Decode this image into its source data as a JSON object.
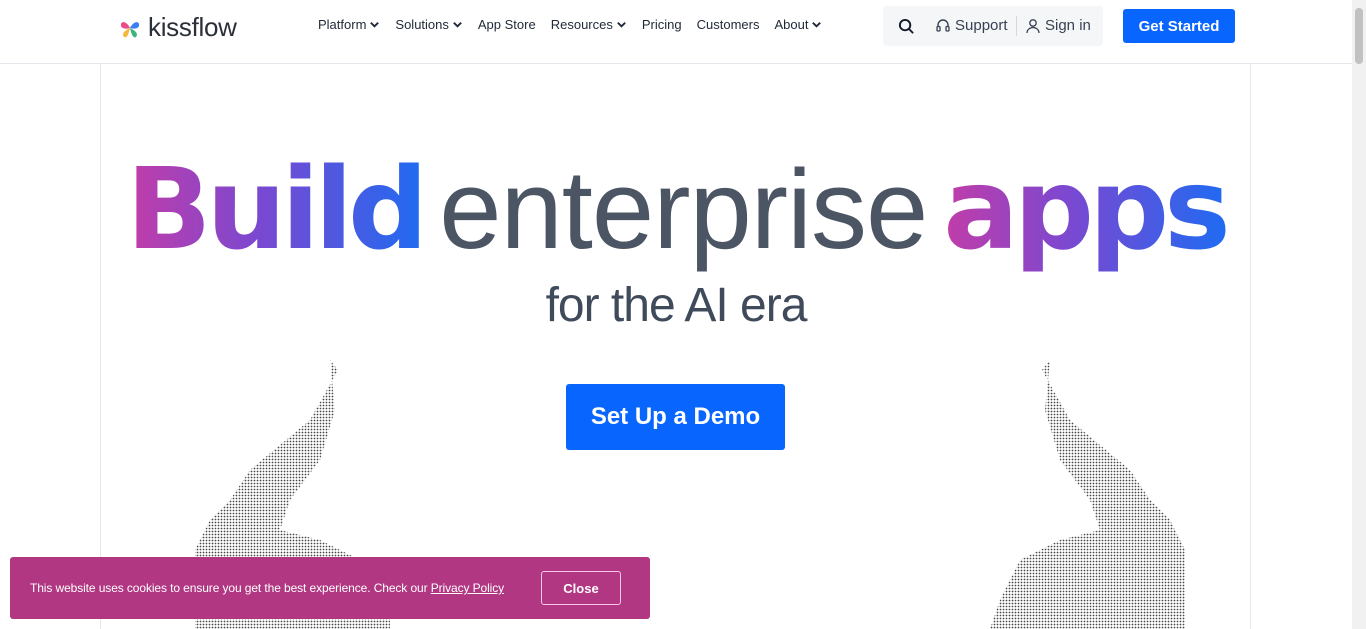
{
  "header": {
    "logo_text": "kissflow",
    "nav": [
      {
        "label": "Platform",
        "has_dropdown": true
      },
      {
        "label": "Solutions",
        "has_dropdown": true
      },
      {
        "label": "App Store",
        "has_dropdown": false
      },
      {
        "label": "Resources",
        "has_dropdown": true
      },
      {
        "label": "Pricing",
        "has_dropdown": false
      },
      {
        "label": "Customers",
        "has_dropdown": false
      },
      {
        "label": "About",
        "has_dropdown": true
      }
    ],
    "support_label": "Support",
    "signin_label": "Sign in",
    "cta_label": "Get Started"
  },
  "hero": {
    "title_word_1": "Build",
    "title_word_2": "enterprise",
    "title_word_3": "apps",
    "subtitle": "for the AI era",
    "cta_label": "Set Up a Demo"
  },
  "cookie_banner": {
    "text": "This website uses cookies to ensure you get the best experience. Check our",
    "link_label": "Privacy Policy",
    "close_label": "Close"
  },
  "colors": {
    "primary_blue": "#0866ff",
    "cookie_bg": "#b13782",
    "gradient_start": "#c23da8",
    "gradient_end": "#1f6bf2"
  },
  "icons": [
    "kissflow-logo-icon",
    "chevron-down-icon",
    "search-icon",
    "headset-icon",
    "user-icon",
    "pointing-hand-illustration"
  ]
}
